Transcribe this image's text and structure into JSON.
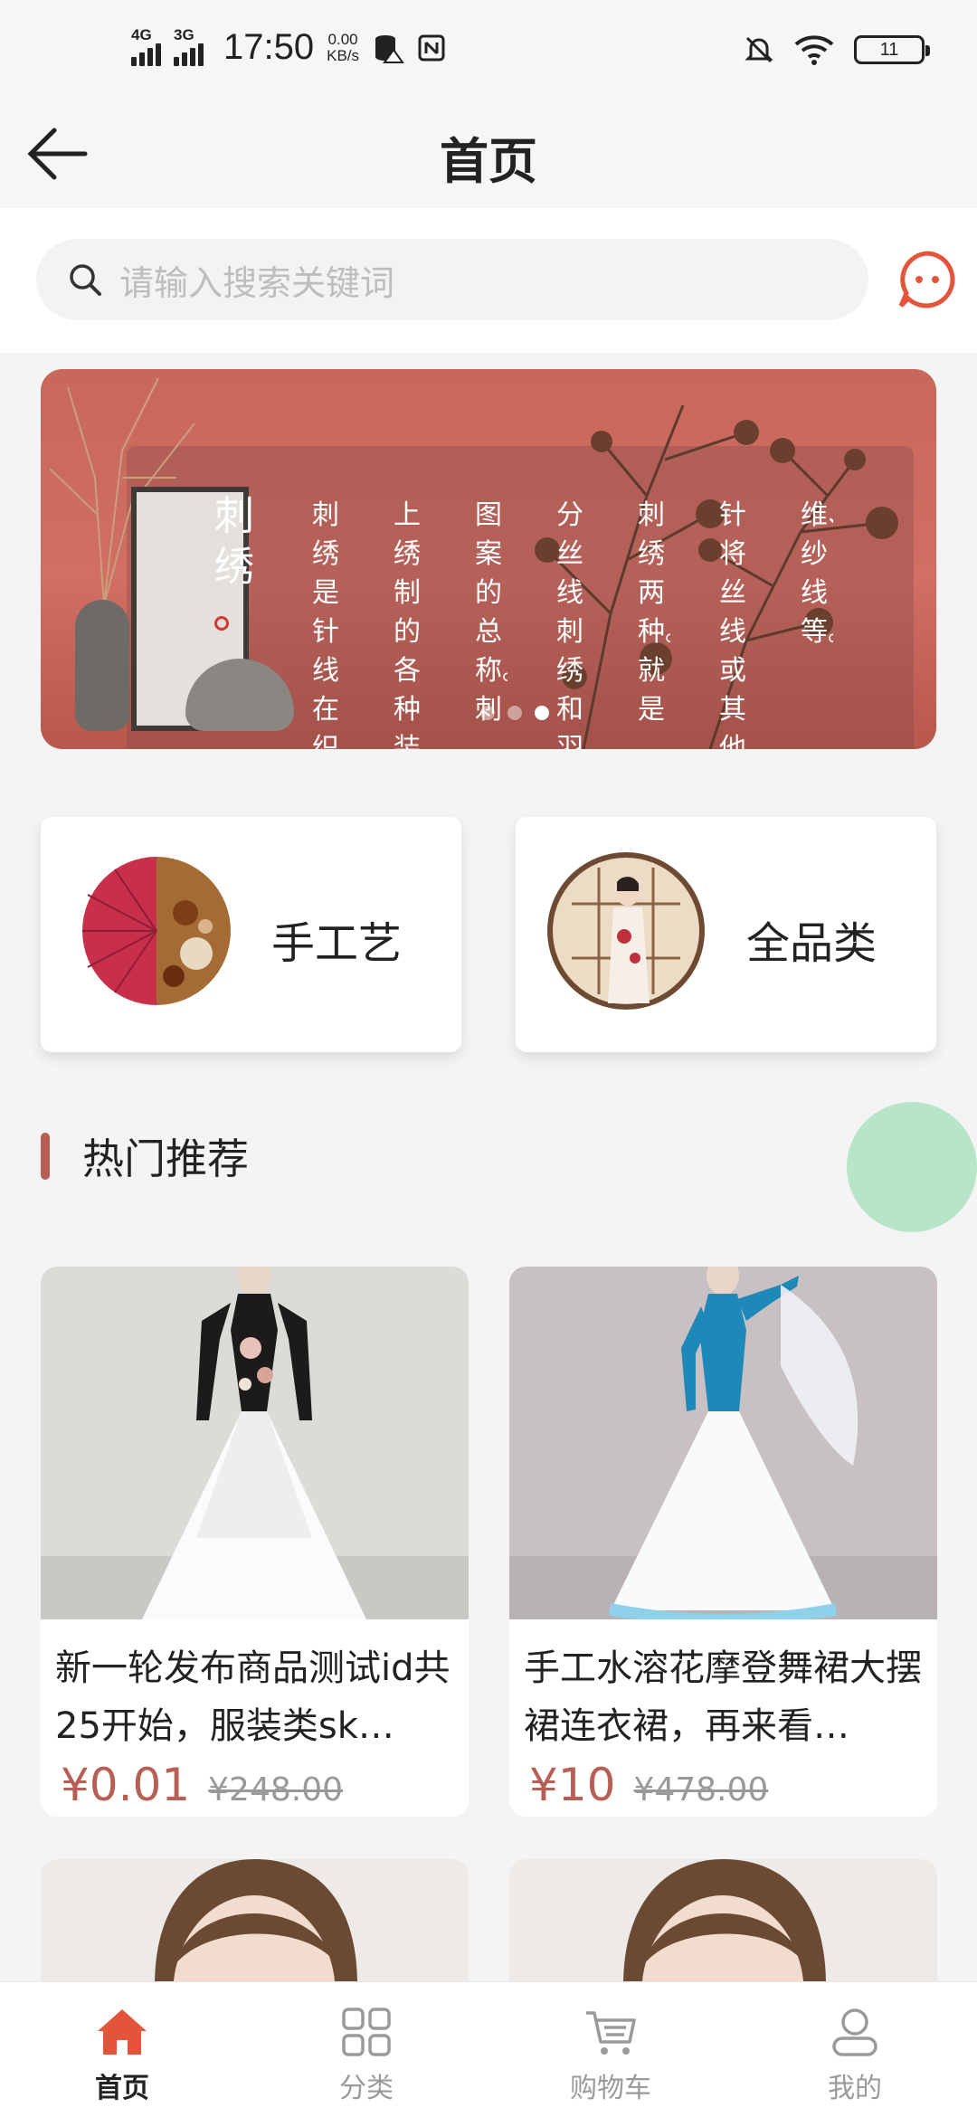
{
  "status_bar": {
    "signal1": "4G",
    "signal2": "3G",
    "time": "17:50",
    "speed_value": "0.00",
    "speed_unit": "KB/s",
    "battery": "11"
  },
  "nav": {
    "title": "首页"
  },
  "search": {
    "placeholder": "请输入搜索关键词"
  },
  "banner": {
    "title": "刺绣",
    "columns": [
      "刺绣是针线在织",
      "上绣制的各种装",
      "图案的总称。刺",
      "分丝线刺绣和羽",
      "刺绣两种。就是",
      "针将丝线或其他",
      "维、纱线等。"
    ],
    "slide_count": 3,
    "active_slide": 3
  },
  "categories": [
    {
      "label": "手工艺",
      "icon": "folding-fan-icon"
    },
    {
      "label": "全品类",
      "icon": "qipao-lady-icon"
    }
  ],
  "section": {
    "title": "热门推荐"
  },
  "products": [
    {
      "name": "新一轮发布商品测试id共25开始，服装类sk…",
      "price": "¥0.01",
      "original_price": "¥248.00"
    },
    {
      "name": "手工水溶花摩登舞裙大摆裙连衣裙，再来看…",
      "price": "¥10",
      "original_price": "¥478.00"
    }
  ],
  "tabbar": {
    "items": [
      {
        "label": "首页",
        "icon": "home-icon",
        "active": true
      },
      {
        "label": "分类",
        "icon": "grid-icon",
        "active": false
      },
      {
        "label": "购物车",
        "icon": "cart-icon",
        "active": false
      },
      {
        "label": "我的",
        "icon": "user-icon",
        "active": false
      }
    ]
  },
  "colors": {
    "accent": "#b75f55",
    "active_tab": "#e4543a",
    "float_button": "#b8e4c8"
  }
}
